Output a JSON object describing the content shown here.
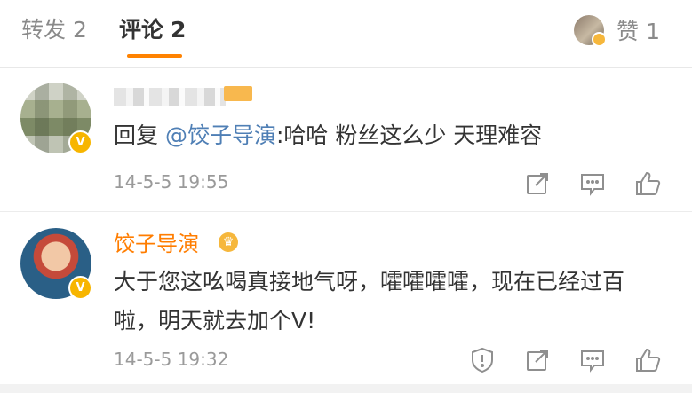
{
  "tabs": {
    "repost": {
      "label": "转发",
      "count": "2"
    },
    "comment": {
      "label": "评论",
      "count": "2"
    },
    "likes": {
      "label": "赞",
      "count": "1"
    }
  },
  "comments": [
    {
      "username": "",
      "reply_prefix": "回复",
      "mention": "@饺子导演",
      "text": ":哈哈 粉丝这么少 天理难容",
      "time": "14-5-5 19:55",
      "badge": "V"
    },
    {
      "username": "饺子导演",
      "text": "大于您这吆喝真接地气呀，嚯嚯嚯嚯，现在已经过百啦，明天就去加个V!",
      "time": "14-5-5 19:32",
      "badge": "V",
      "crown": "♛"
    }
  ],
  "icons": {
    "share": "share-icon",
    "comment": "comment-icon",
    "like": "thumb-up-icon",
    "report": "report-icon"
  },
  "colors": {
    "accent": "#ff8200",
    "username": "#ff7d00",
    "mention": "#4f7fb5",
    "badge": "#f7b500"
  }
}
